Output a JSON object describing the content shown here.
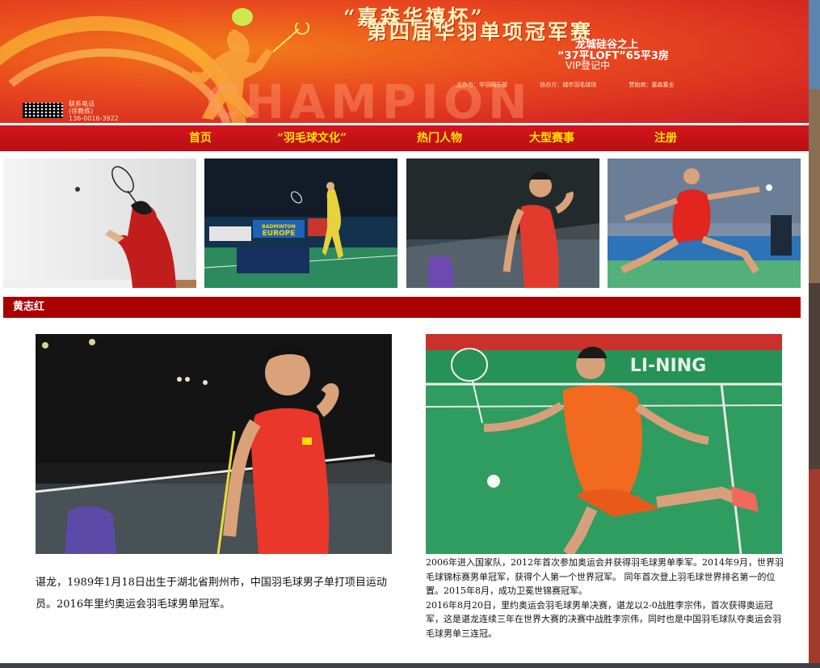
{
  "banner": {
    "title_line1": "“嘉森华禧杯”",
    "title_line2": "第四届华羽单项冠军赛",
    "ad_line1": "龙城硅谷之上",
    "ad_line2": "“37平LOFT”65平3房",
    "ad_line3": "VIP登记中",
    "organizers": [
      "主办方：华羽网乐部",
      "协办方：城市羽毛球场",
      "赞助商：嘉森置业"
    ],
    "watermark": "CHAMPION",
    "contact_label": "联系电话",
    "contact_name": "(徐教练)",
    "contact_phone": "136-0016-3922"
  },
  "nav": {
    "items": [
      {
        "label": "首页"
      },
      {
        "label": "“羽毛球文化”"
      },
      {
        "label": "热门人物"
      },
      {
        "label": "大型赛事"
      },
      {
        "label": "注册"
      }
    ]
  },
  "gallery": {
    "items": [
      {
        "name": "player-smash"
      },
      {
        "name": "badminton-europe-match"
      },
      {
        "name": "chen-long-celebration"
      },
      {
        "name": "player-lunge"
      }
    ],
    "scoreboard_brand": "BADMINTON EUROPE"
  },
  "section": {
    "title": "黄志红"
  },
  "photo_right_logo": "LI-NING",
  "article": {
    "left_text": "谌龙，1989年1月18日出生于湖北省荆州市，中国羽毛球男子单打项目运动员。2016年里约奥运会羽毛球男单冠军。",
    "right_paragraph1": "2006年进入国家队，2012年首次参加奥运会并获得羽毛球男单季军。2014年9月，世界羽毛球锦标赛男单冠军，获得个人第一个世界冠军。 同年首次登上羽毛球世界排名第一的位置。2015年8月，成功卫冕世锦赛冠军。",
    "right_paragraph2": "2016年8月20日，里约奥运会羽毛球男单决赛，谌龙以2-0战胜李宗伟，首次获得奥运冠军，这是谌龙连续三年在世界大赛的决赛中战胜李宗伟，同时也是中国羽毛球队夺奥运会羽毛球男单三连冠。"
  },
  "colors": {
    "nav_bg": "#c8141a",
    "nav_text": "#ffe300",
    "section_bar": "#a90000",
    "court_green": "#2e9a5a"
  }
}
